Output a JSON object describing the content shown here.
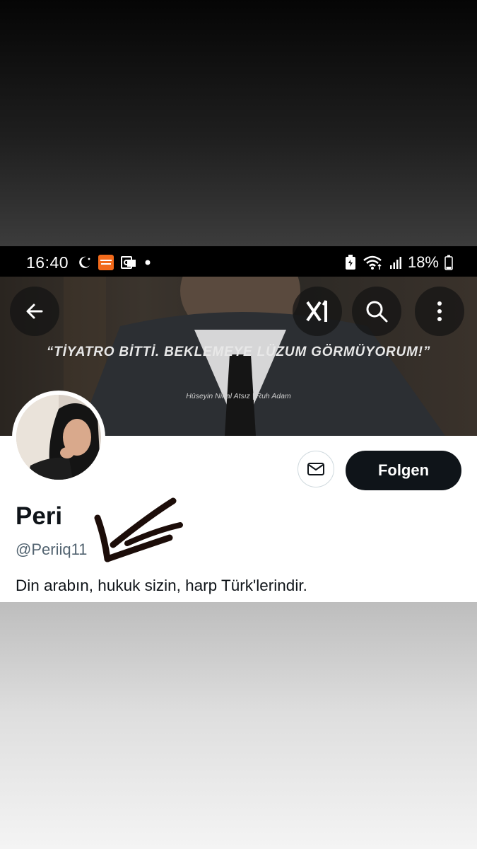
{
  "status_bar": {
    "time": "16:40",
    "battery_percent": "18%"
  },
  "banner": {
    "quote": "“TİYATRO BİTTİ. BEKLEMEYE LÜZUM GÖRMÜYORUM!”",
    "attribution": "Hüseyin Nihal Atsız | Ruh Adam"
  },
  "profile": {
    "name": "Peri",
    "handle": "@Periiq11",
    "bio": "Din arabın, hukuk sizin, harp Türk'lerindir.",
    "follow_label": "Folgen"
  },
  "icons": {
    "back": "arrow-left-icon",
    "grok": "grok-icon",
    "search": "search-icon",
    "more": "more-vertical-icon",
    "message": "envelope-icon"
  }
}
